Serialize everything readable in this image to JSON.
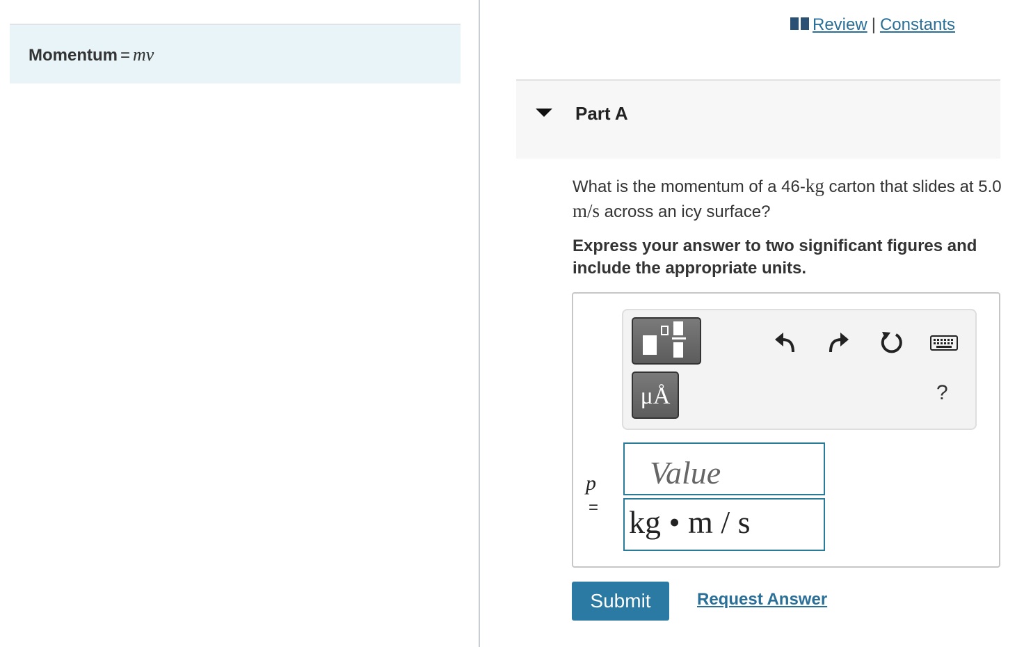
{
  "hint": {
    "label": "Momentum",
    "equals": "=",
    "formula": "mv"
  },
  "top_links": {
    "review": "Review",
    "separator": "|",
    "constants": "Constants"
  },
  "part": {
    "title": "Part A"
  },
  "question": {
    "text_1": "What is the momentum of a 46-",
    "unit_kg": "kg",
    "text_2": " carton that slides at 5.0 ",
    "unit_ms": "m/s",
    "text_3": " across an icy surface?"
  },
  "instruction": "Express your answer to two significant figures and include the appropriate units.",
  "toolbar": {
    "units_label": "μÅ",
    "help": "?"
  },
  "answer": {
    "variable": "p",
    "equals": "=",
    "value_placeholder": "Value",
    "value": "",
    "units": "kg • m / s"
  },
  "buttons": {
    "submit": "Submit",
    "request_answer": "Request Answer"
  },
  "colors": {
    "accent": "#2a7aa3",
    "link": "#2a6f97",
    "hint_bg": "#e8f4f7"
  }
}
